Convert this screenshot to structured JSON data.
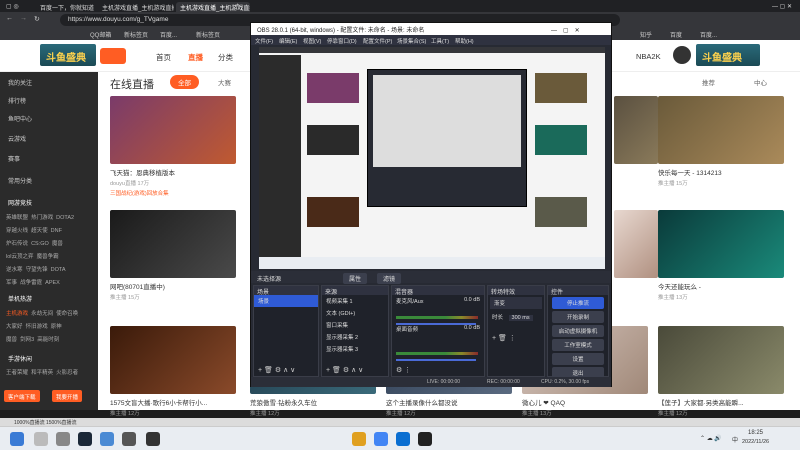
{
  "browser": {
    "tabs": [
      "百度一下，你就知道",
      "主机游戏直播_主机游戏直播...",
      "主机游戏直播_主机游戏直播...",
      "+"
    ],
    "url": "https://www.douyu.com/g_TVgame",
    "bookmarks": [
      "QQ邮箱",
      "新标签页",
      "百度...",
      "新标签页",
      "新标签页",
      "知乎",
      "百度",
      "百度..."
    ],
    "status": "1000%直播流   1500%直播流"
  },
  "site": {
    "logo_left": "斗鱼盛典",
    "nav": [
      "首页",
      "直播",
      "分类",
      "大赛"
    ],
    "nav_right": [
      "NBA2K",
      "推荐",
      "中心"
    ],
    "page_title": "在线直播",
    "page_badge": "全部",
    "page_badge2": "大赛"
  },
  "sidebar": {
    "items": [
      "我的关注",
      "排行榜",
      "鱼吧中心",
      "云游戏",
      "赛事",
      "常用分类"
    ],
    "section1": "网游竞技",
    "grid1": [
      "英雄联盟",
      "热门游戏",
      "DOTA2",
      "穿越火线",
      "超天使",
      "DNF",
      "炉石传说",
      "CS:GO",
      "魔兽",
      "lol云顶之弈",
      "魔兽争霸",
      "魔兽世界",
      "逆水寒",
      "守望先锋",
      "DOTA",
      "军事",
      "战争雷霆",
      "APEX"
    ],
    "section2": "单机热游",
    "grid2": [
      "主机游戏",
      "永劫无间",
      "使命召唤",
      "大家好",
      "怀旧游戏",
      "原神",
      "魔兽",
      "剑网3",
      "高能时刻"
    ],
    "section3": "手游休闲",
    "grid3": [
      "王者荣耀",
      "和平精英",
      "火影忍者"
    ],
    "btn_download": "客户端下载",
    "btn_open": "我要开播"
  },
  "cards": [
    {
      "title": "飞天猫：恩典移植版本",
      "meta": "douyu直播  17万",
      "extra": "三国战纪(游戏)回放合集",
      "bg": "#7a3b6a"
    },
    {
      "title": "网吧(80701直播中)",
      "meta": "推主播  15万",
      "bg": "#2a2a2a"
    },
    {
      "title": "1575文盲大播·歌行6小卡帮行小...",
      "meta": "推主播  12万",
      "bg": "#4a2a18"
    },
    {
      "title": "荒狼傲雪·钻粉永久车位",
      "meta": "推主播  12万",
      "bg": "#1f3a4a"
    },
    {
      "title": "这个主播录像什么都没说",
      "meta": "推主播  12万",
      "bg": "#2f3f55"
    },
    {
      "title": "微心儿 ❤ QAQ",
      "meta": "推主播  13万",
      "bg": "#d8c8c0"
    },
    {
      "title": "快乐每一天 - 1314213",
      "meta": "推主播  15万",
      "bg": "#6a5a3a"
    },
    {
      "title": "今天还能玩么 -",
      "meta": "推主播  13万",
      "bg": "#1a6a5a"
    },
    {
      "title": "【莲子】大家都·另类高能瞬...",
      "meta": "推主播  12万",
      "bg": "#5a5a4a"
    }
  ],
  "obs": {
    "title": "OBS 28.0.1 (64-bit, windows) - 配置文件: 未命名 - 场景: 未命名",
    "menu": [
      "文件(F)",
      "编辑(E)",
      "视图(V)",
      "停靠窗口(D)",
      "配置文件(P)",
      "场景集合(S)",
      "工具(T)",
      "帮助(H)"
    ],
    "source_label": "未选择源",
    "props_label": "属性",
    "filters_label": "滤镜",
    "docks": {
      "scenes": "场景",
      "sources": "来源",
      "mixer": "混音器",
      "transitions": "转场特效",
      "controls": "控件"
    },
    "scene_item": "场景",
    "source_items": [
      "视频采集 1",
      "文本 (GDI+)",
      "窗口采集",
      "显示器采集 2",
      "显示器采集 3"
    ],
    "mixer": [
      {
        "name": "麦克风/Aux",
        "db": "0.0 dB"
      },
      {
        "name": "桌面音频",
        "db": "0.0 dB"
      }
    ],
    "transition": "渐变",
    "duration_label": "时长",
    "duration": "300 ms",
    "controls": [
      "停止推流",
      "开始录制",
      "启动虚拟摄像机",
      "工作室模式",
      "设置",
      "退出"
    ],
    "status": {
      "live": "LIVE: 00:00:00",
      "rec": "REC: 00:00:00",
      "cpu": "CPU: 0.2%, 30.00 fps"
    }
  },
  "taskbar": {
    "time": "18:25",
    "date": "2022/11/26",
    "lang": "中"
  }
}
